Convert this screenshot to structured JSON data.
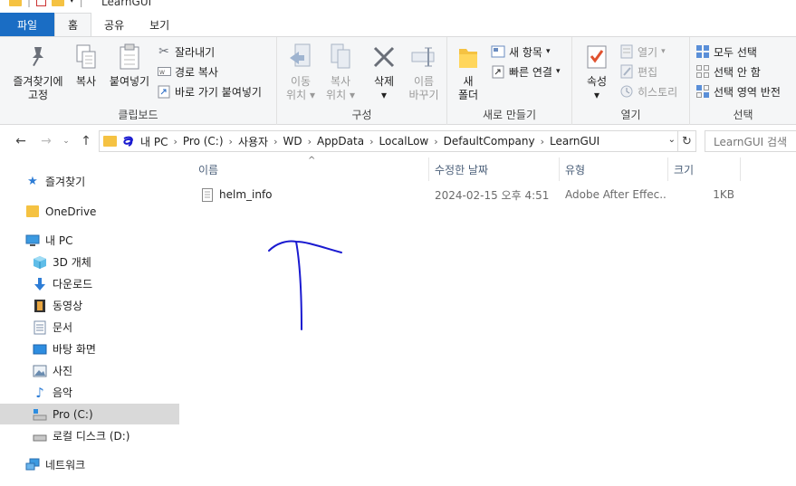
{
  "window": {
    "title": "LearnGUI"
  },
  "tabs": [
    {
      "label": "파일"
    },
    {
      "label": "홈"
    },
    {
      "label": "공유"
    },
    {
      "label": "보기"
    }
  ],
  "ribbon": {
    "clipboard": {
      "label": "클립보드",
      "pin_line1": "즐겨찾기에",
      "pin_line2": "고정",
      "copy": "복사",
      "paste": "붙여넣기",
      "cut": "잘라내기",
      "copy_path": "경로 복사",
      "paste_shortcut": "바로 가기 붙여넣기"
    },
    "organize": {
      "label": "구성",
      "move_line1": "이동",
      "move_line2": "위치",
      "copyto_line1": "복사",
      "copyto_line2": "위치",
      "delete": "삭제",
      "rename_line1": "이름",
      "rename_line2": "바꾸기"
    },
    "new": {
      "label": "새로 만들기",
      "newfolder_line1": "새",
      "newfolder_line2": "폴더",
      "new_item": "새 항목",
      "easy_access": "빠른 연결"
    },
    "open": {
      "label": "열기",
      "properties": "속성",
      "open": "열기",
      "edit": "편집",
      "history": "히스토리"
    },
    "select": {
      "label": "선택",
      "select_all": "모두 선택",
      "select_none": "선택 안 함",
      "invert": "선택 영역 반전"
    }
  },
  "address": {
    "crumbs": [
      "내 PC",
      "Pro (C:)",
      "사용자",
      "WD",
      "AppData",
      "LocalLow",
      "DefaultCompany",
      "LearnGUI"
    ],
    "search_placeholder": "LearnGUI 검색"
  },
  "navpane": {
    "quick_access": "즐겨찾기",
    "onedrive": "OneDrive",
    "this_pc": "내 PC",
    "objects3d": "3D 개체",
    "downloads": "다운로드",
    "videos": "동영상",
    "documents": "문서",
    "desktop": "바탕 화면",
    "pictures": "사진",
    "music": "음악",
    "drive_c": "Pro (C:)",
    "drive_d": "로컬 디스크 (D:)",
    "network": "네트워크"
  },
  "columns": {
    "name": "이름",
    "modified": "수정한 날짜",
    "type": "유형",
    "size": "크기"
  },
  "files": [
    {
      "name": "helm_info",
      "modified": "2024-02-15 오후 4:51",
      "type": "Adobe After Effec...",
      "size": "1KB"
    }
  ],
  "colors": {
    "accent": "#1a6dc4",
    "selected_nav": "#d9d9d9",
    "annotation_ink": "#1a1ad0"
  }
}
